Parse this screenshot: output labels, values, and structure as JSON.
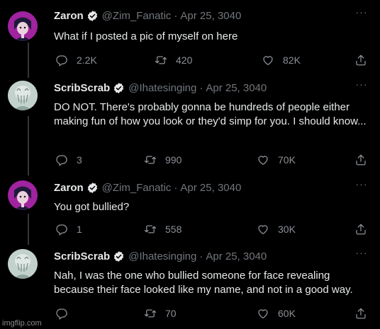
{
  "tweets": [
    {
      "name": "Zaron",
      "handle": "@Zim_Fanatic",
      "dot": "·",
      "date": "Apr 25, 3040",
      "text": "What if I posted a pic of myself on here",
      "replies": "2.2K",
      "retweets": "420",
      "likes": "82K",
      "avatar": "zaron"
    },
    {
      "name": "ScribScrab",
      "handle": "@Ihatesinging",
      "dot": "·",
      "date": "Apr 25, 3040",
      "text": "DO NOT. There's probably gonna be hundreds of people either making fun of how you look or they'd simp for you. I should know...",
      "replies": "3",
      "retweets": "990",
      "likes": "70K",
      "avatar": "scribscrab"
    },
    {
      "name": "Zaron",
      "handle": "@Zim_Fanatic",
      "dot": "·",
      "date": "Apr 25, 3040",
      "text": "You got bullied?",
      "replies": "1",
      "retweets": "558",
      "likes": "30K",
      "avatar": "zaron"
    },
    {
      "name": "ScribScrab",
      "handle": "@Ihatesinging",
      "dot": "·",
      "date": "Apr 25, 3040",
      "text": "Nah, I was the one who bullied someone for face revealing because their face looked like my name, and not in a good way.",
      "replies": "",
      "retweets": "70",
      "likes": "60K",
      "avatar": "scribscrab"
    }
  ],
  "more_glyph": "···",
  "watermark": "imgflip.com",
  "colors": {
    "background": "#000000",
    "text": "#e7e9ea",
    "muted": "#71767b",
    "verified": "#e7e9ea",
    "thread_line": "#333639"
  }
}
